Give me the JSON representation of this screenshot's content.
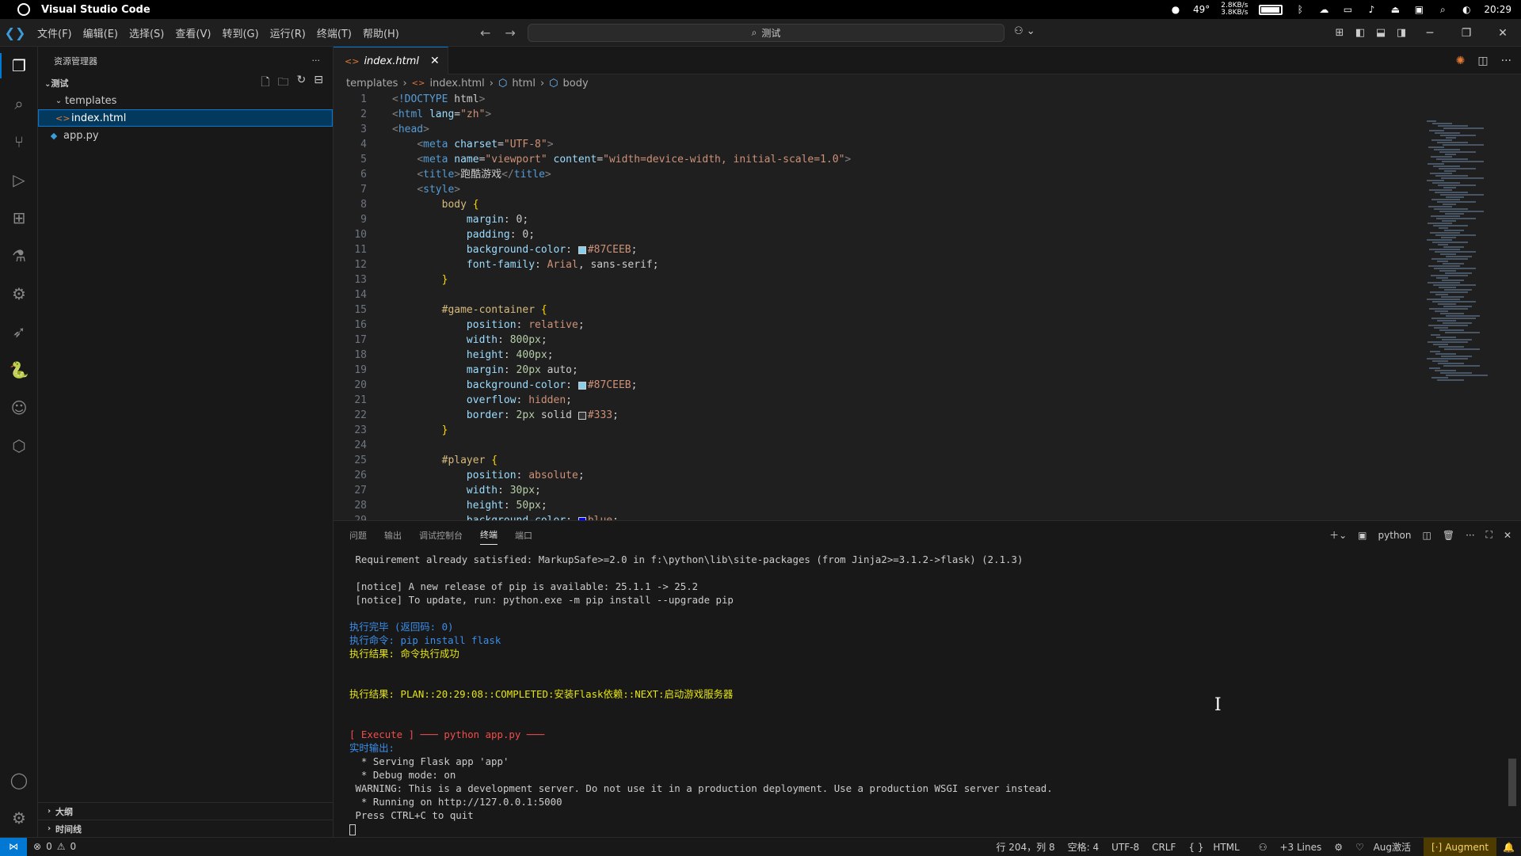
{
  "os": {
    "app_name": "Visual Studio Code",
    "temp1": "49°",
    "temp2": "49°",
    "net_up": "2.8KB/s",
    "net_down": "3.8KB/s",
    "clock": "20:29"
  },
  "titlebar": {
    "menu": [
      "文件(F)",
      "编辑(E)",
      "选择(S)",
      "查看(V)",
      "转到(G)",
      "运行(R)",
      "终端(T)",
      "帮助(H)"
    ],
    "search": "测试"
  },
  "sidebar": {
    "title": "资源管理器",
    "folder": "测试",
    "items": [
      {
        "label": "templates",
        "type": "folder"
      },
      {
        "label": "index.html",
        "type": "html"
      },
      {
        "label": "app.py",
        "type": "python"
      }
    ],
    "outline": "大纲",
    "timeline": "时间线"
  },
  "editor": {
    "tab": "index.html",
    "breadcrumbs": [
      "templates",
      "index.html",
      "html",
      "body"
    ]
  },
  "code_lines": [
    "<!DOCTYPE html>",
    "<html lang=\"zh\">",
    "<head>",
    "    <meta charset=\"UTF-8\">",
    "    <meta name=\"viewport\" content=\"width=device-width, initial-scale=1.0\">",
    "    <title>跑酷游戏</title>",
    "    <style>",
    "        body {",
    "            margin: 0;",
    "            padding: 0;",
    "            background-color: #87CEEB;",
    "            font-family: Arial, sans-serif;",
    "        }",
    "",
    "        #game-container {",
    "            position: relative;",
    "            width: 800px;",
    "            height: 400px;",
    "            margin: 20px auto;",
    "            background-color: #87CEEB;",
    "            overflow: hidden;",
    "            border: 2px solid #333;",
    "        }",
    "",
    "        #player {",
    "            position: absolute;",
    "            width: 30px;",
    "            height: 50px;",
    "            background-color: blue;"
  ],
  "panel": {
    "tabs": [
      "问题",
      "输出",
      "调试控制台",
      "终端",
      "端口"
    ],
    "active_tab": "终端",
    "shell": "python"
  },
  "terminal_lines": [
    {
      "text": " Requirement already satisfied: MarkupSafe>=2.0 in f:\\python\\lib\\site-packages (from Jinja2>=3.1.2->flask) (2.1.3)",
      "color": ""
    },
    {
      "text": "",
      "color": ""
    },
    {
      "text": " [notice] A new release of pip is available: 25.1.1 -> 25.2",
      "color": ""
    },
    {
      "text": " [notice] To update, run: python.exe -m pip install --upgrade pip",
      "color": ""
    },
    {
      "text": "",
      "color": ""
    },
    {
      "text": "执行完毕 (返回码: 0)",
      "color": "blue"
    },
    {
      "text": "执行命令: pip install flask",
      "color": "blue"
    },
    {
      "text": "执行结果: 命令执行成功",
      "color": "yel"
    },
    {
      "text": "",
      "color": ""
    },
    {
      "text": "",
      "color": ""
    },
    {
      "text": "执行结果: PLAN::20:29:08::COMPLETED:安装Flask依赖::NEXT:启动游戏服务器",
      "color": "yel"
    },
    {
      "text": "",
      "color": ""
    },
    {
      "text": "",
      "color": ""
    },
    {
      "text": "[ Execute ] ─── python app.py ───",
      "color": "red"
    },
    {
      "text": "实时输出:",
      "color": "blue"
    },
    {
      "text": "  * Serving Flask app 'app'",
      "color": ""
    },
    {
      "text": "  * Debug mode: on",
      "color": ""
    },
    {
      "text": " WARNING: This is a development server. Do not use it in a production deployment. Use a production WSGI server instead.",
      "color": ""
    },
    {
      "text": "  * Running on http://127.0.0.1:5000",
      "color": ""
    },
    {
      "text": " Press CTRL+C to quit",
      "color": ""
    }
  ],
  "status": {
    "errors": "0",
    "warnings": "0",
    "position": "行 204，列 8",
    "spaces": "空格: 4",
    "encoding": "UTF-8",
    "eol": "CRLF",
    "language": "HTML",
    "lines": "+3 Lines",
    "aug": "Aug激活",
    "augment": "Augment"
  },
  "colors": {
    "accent": "#0078d4",
    "swatch_sky": "#87CEEB",
    "swatch_dark": "#333333",
    "swatch_blue": "#0000ff"
  }
}
